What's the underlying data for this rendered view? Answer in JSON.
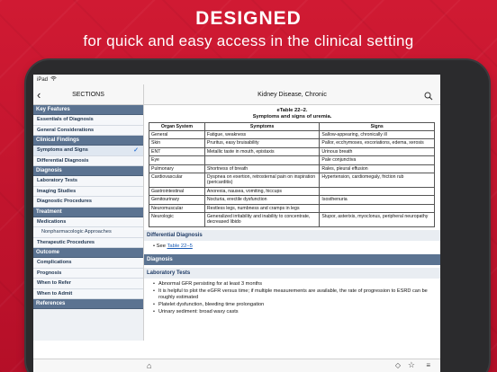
{
  "promo": {
    "headline": "DESIGNED",
    "subline": "for quick and easy access in the clinical setting"
  },
  "status": {
    "device": "iPad",
    "wifi": "wifi-icon"
  },
  "nav": {
    "left_title": "SECTIONS",
    "title": "Kidney Disease, Chronic"
  },
  "sidebar": {
    "sections": [
      {
        "header": "Key Features",
        "items": [
          {
            "label": "Essentials of Diagnosis",
            "sub": false,
            "selected": false
          },
          {
            "label": "General Considerations",
            "sub": false,
            "selected": false
          }
        ]
      },
      {
        "header": "Clinical Findings",
        "items": [
          {
            "label": "Symptoms and Signs",
            "sub": false,
            "selected": true
          },
          {
            "label": "Differential Diagnosis",
            "sub": false,
            "selected": false
          }
        ]
      },
      {
        "header": "Diagnosis",
        "items": [
          {
            "label": "Laboratory Tests",
            "sub": false,
            "selected": false
          },
          {
            "label": "Imaging Studies",
            "sub": false,
            "selected": false
          },
          {
            "label": "Diagnostic Procedures",
            "sub": false,
            "selected": false
          }
        ]
      },
      {
        "header": "Treatment",
        "items": [
          {
            "label": "Medications",
            "sub": false,
            "selected": false
          },
          {
            "label": "Nonpharmacologic Approaches",
            "sub": true,
            "selected": false
          },
          {
            "label": "Therapeutic Procedures",
            "sub": false,
            "selected": false
          }
        ]
      },
      {
        "header": "Outcome",
        "items": [
          {
            "label": "Complications",
            "sub": false,
            "selected": false
          },
          {
            "label": "Prognosis",
            "sub": false,
            "selected": false
          },
          {
            "label": "When to Refer",
            "sub": false,
            "selected": false
          },
          {
            "label": "When to Admit",
            "sub": false,
            "selected": false
          }
        ]
      },
      {
        "header": "References",
        "items": []
      }
    ]
  },
  "content": {
    "table_id": "eTable 22–2.",
    "table_title": "Symptoms and signs of uremia.",
    "columns": [
      "Organ System",
      "Symptoms",
      "Signs"
    ],
    "rows": [
      [
        "General",
        "Fatigue, weakness",
        "Sallow-appearing, chronically ill"
      ],
      [
        "Skin",
        "Pruritus, easy bruisability",
        "Pallor, ecchymoses, excoriations, edema, xerosis"
      ],
      [
        "ENT",
        "Metallic taste in mouth, epistaxis",
        "Urinous breath"
      ],
      [
        "Eye",
        "",
        "Pale conjunctiva"
      ],
      [
        "Pulmonary",
        "Shortness of breath",
        "Rales, pleural effusion"
      ],
      [
        "Cardiovascular",
        "Dyspnea on exertion, retrosternal pain on inspiration (pericarditis)",
        "Hypertension, cardiomegaly, friction rub"
      ],
      [
        "Gastrointestinal",
        "Anorexia, nausea, vomiting, hiccups",
        ""
      ],
      [
        "Genitourinary",
        "Nocturia, erectile dysfunction",
        "Isosthenuria"
      ],
      [
        "Neuromuscular",
        "Restless legs, numbness and cramps in legs",
        ""
      ],
      [
        "Neurologic",
        "Generalized irritability and inability to concentrate, decreased libido",
        "Stupor, asterixis, myoclonus, peripheral neuropathy"
      ]
    ],
    "diff_header": "Differential Diagnosis",
    "diff_see": "See ",
    "diff_link": "Table 22–5",
    "diagnosis_header": "Diagnosis",
    "lab_header": "Laboratory Tests",
    "lab_bullets": [
      "Abnormal GFR persisting for at least 3 months",
      "It is helpful to plot the eGFR versus time; if multiple measurements are available, the rate of progression to ESRD can be roughly estimated",
      "Platelet dysfunction, bleeding time prolongation",
      "Urinary sediment: broad waxy casts"
    ]
  }
}
